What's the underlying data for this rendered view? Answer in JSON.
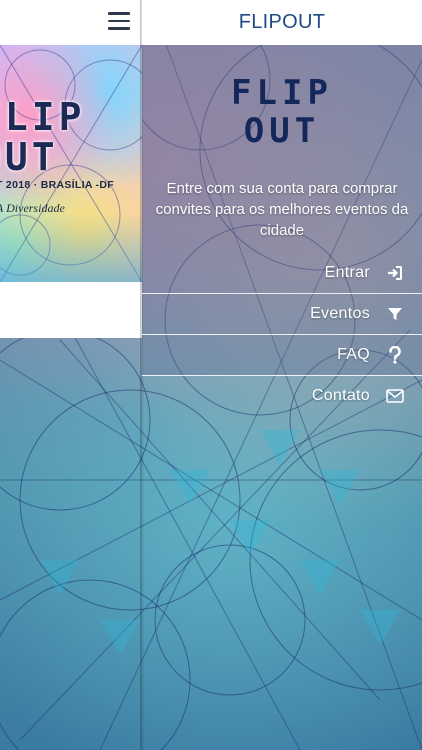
{
  "app": {
    "title": "FLIPOUT"
  },
  "poster": {
    "logo_line1": "FLIP",
    "logo_line2": "OUT",
    "subtitle": "T 2018 · BRASÍLIA -DF",
    "subtitle2": "A Diversidade"
  },
  "drawer": {
    "logo_line1": "FLIP",
    "logo_line2": "OUT",
    "tagline": "Entre com sua conta para comprar convites para os melhores eventos da cidade",
    "menu": [
      {
        "label": "Entrar",
        "icon": "sign-in-icon"
      },
      {
        "label": "Eventos",
        "icon": "filter-icon"
      },
      {
        "label": "FAQ",
        "icon": "question-icon"
      },
      {
        "label": "Contato",
        "icon": "envelope-icon"
      }
    ]
  },
  "colors": {
    "accent": "#1f4a82",
    "header_bg": "#ffffff",
    "menu_text": "#ffffff"
  }
}
